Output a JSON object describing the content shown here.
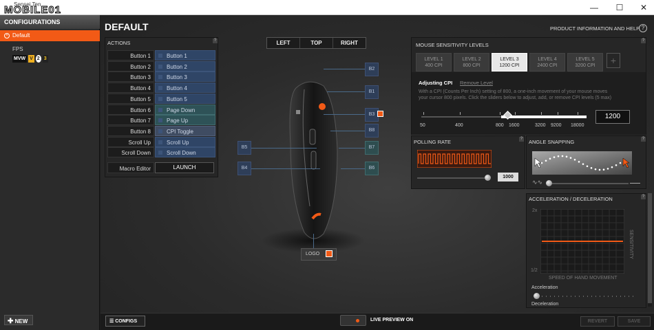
{
  "window": {
    "title": "Sensei Ten",
    "logo": "MOBILE01",
    "minimize": "—",
    "maximize": "☐",
    "close": "✕"
  },
  "sidebar": {
    "header": "CONFIGURATIONS",
    "configs": [
      {
        "label": "Default"
      },
      {
        "label": "FPS"
      }
    ],
    "fps_icons": [
      "MVW",
      "V",
      "2",
      "3"
    ],
    "new_label": "NEW"
  },
  "main": {
    "title": "DEFAULT",
    "product_info": "PRODUCT INFORMATION AND HELP"
  },
  "actions": {
    "title": "ACTIONS",
    "help": "?",
    "rows": [
      {
        "key": "Button 1",
        "value": "Button 1"
      },
      {
        "key": "Button 2",
        "value": "Button 2"
      },
      {
        "key": "Button 3",
        "value": "Button 3"
      },
      {
        "key": "Button 4",
        "value": "Button 4"
      },
      {
        "key": "Button 5",
        "value": "Button 5"
      },
      {
        "key": "Button 6",
        "value": "Page Down"
      },
      {
        "key": "Button 7",
        "value": "Page Up"
      },
      {
        "key": "Button 8",
        "value": "CPI Toggle"
      },
      {
        "key": "Scroll Up",
        "value": "Scroll Up"
      },
      {
        "key": "Scroll Down",
        "value": "Scroll Down"
      }
    ],
    "macro_label": "Macro Editor",
    "launch_label": "LAUNCH"
  },
  "view": {
    "tabs": [
      "LEFT",
      "TOP",
      "RIGHT"
    ]
  },
  "mouse": {
    "labels": [
      "B2",
      "B1",
      "B3",
      "B8",
      "B5",
      "B7",
      "B4",
      "B6"
    ],
    "logo_label": "LOGO"
  },
  "sensitivity": {
    "title": "MOUSE SENSITIVITY LEVELS",
    "help": "?",
    "levels": [
      {
        "name": "LEVEL 1",
        "cpi": "400 CPI"
      },
      {
        "name": "LEVEL 2",
        "cpi": "800 CPI"
      },
      {
        "name": "LEVEL 3",
        "cpi": "1200 CPI"
      },
      {
        "name": "LEVEL 4",
        "cpi": "2400 CPI"
      },
      {
        "name": "LEVEL 5",
        "cpi": "3200 CPI"
      }
    ],
    "add": "+",
    "adjusting": "Adjusting CPI",
    "remove": "Remove Level",
    "desc1": "With a CPI (Counts Per Inch) setting of 800, a one-inch movement of your mouse moves",
    "desc2": "your cursor 800 pixels. Click the sliders below to adjust, add, or remove CPI levels (5 max)",
    "scale": [
      "50",
      "400",
      "800",
      "1600",
      "3200",
      "9200",
      "18000"
    ],
    "value": "1200"
  },
  "polling": {
    "title": "POLLING RATE",
    "help": "?",
    "value": "1000"
  },
  "angle": {
    "title": "ANGLE SNAPPING",
    "help": "?"
  },
  "accel": {
    "title": "ACCELERATION / DECELERATION",
    "help": "?",
    "y_top": "2x",
    "y_bottom": "1/2",
    "x_label": "SPEED OF HAND MOVEMENT",
    "y_label": "SENSITIVITY",
    "accel_label": "Acceleration",
    "decel_label": "Deceleration"
  },
  "bottom": {
    "configs": "CONFIGS",
    "live": "LIVE PREVIEW ON",
    "revert": "REVERT",
    "save": "SAVE"
  },
  "colors": {
    "accent": "#f25a16"
  }
}
